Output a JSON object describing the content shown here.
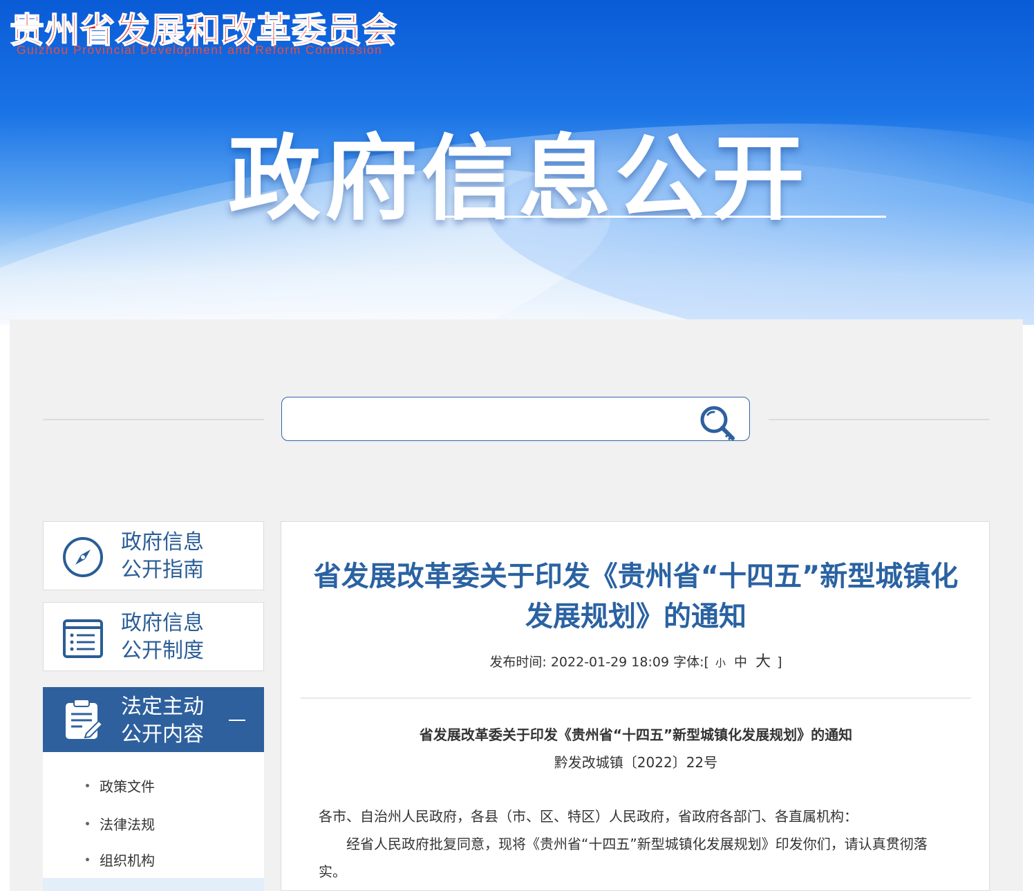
{
  "header": {
    "org_name_cn": "贵州省发展和改革委员会",
    "org_name_en": "Guizhou Provincial Development and Reform Commission",
    "hero_title": "政府信息公开"
  },
  "search": {
    "value": "",
    "placeholder": ""
  },
  "sidebar": {
    "cards": [
      {
        "line1": "政府信息",
        "line2": "公开指南",
        "icon": "compass-icon"
      },
      {
        "line1": "政府信息",
        "line2": "公开制度",
        "icon": "list-document-icon"
      },
      {
        "line1": "法定主动",
        "line2": "公开内容",
        "icon": "clipboard-edit-icon",
        "expanded": true
      }
    ],
    "sub_items": [
      "政策文件",
      "法律法规",
      "组织机构"
    ]
  },
  "article": {
    "title": "省发展改革委关于印发《贵州省“十四五”新型城镇化发展规划》的通知",
    "meta": {
      "publish_label": "发布时间:",
      "publish_time": "2022-01-29 18:09",
      "font_label": "字体:[",
      "font_small": "小",
      "font_medium": "中",
      "font_large": "大",
      "font_close": "]"
    },
    "doc_title": "省发展改革委关于印发《贵州省“十四五”新型城镇化发展规划》的通知",
    "doc_number": "黔发改城镇〔2022〕22号",
    "paragraphs": [
      "各市、自治州人民政府，各县（市、区、特区）人民政府，省政府各部门、各直属机构：",
      "经省人民政府批复同意，现将《贵州省“十四五”新型城镇化发展规划》印发你们，请认真贯彻落实。"
    ]
  },
  "colors": {
    "brand_red": "#d8271c",
    "primary_blue": "#2e609d",
    "title_blue": "#2a62a2",
    "panel_grey": "#f1f1f1"
  }
}
